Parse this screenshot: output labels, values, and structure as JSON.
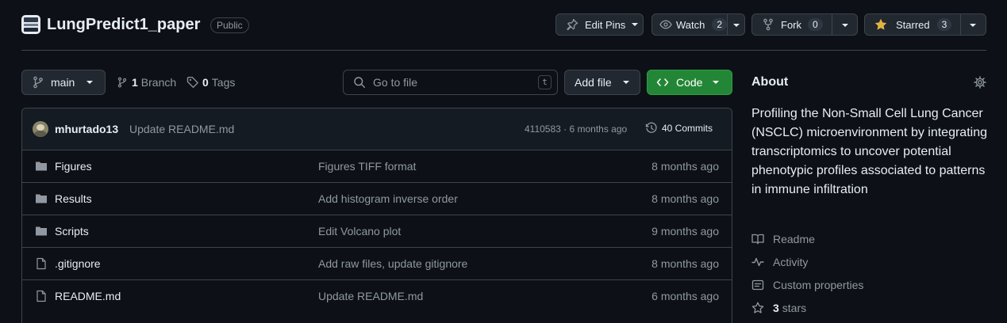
{
  "repo": {
    "name": "LungPredict1_paper",
    "visibility": "Public"
  },
  "header_actions": {
    "edit_pins": "Edit Pins",
    "watch": "Watch",
    "watch_count": "2",
    "fork": "Fork",
    "fork_count": "0",
    "starred": "Starred",
    "star_count": "3"
  },
  "toolbar": {
    "branch": "main",
    "branch_count": "1",
    "branch_label": "Branch",
    "tag_count": "0",
    "tag_label": "Tags",
    "go_to_file_placeholder": "Go to file",
    "go_to_file_key": "t",
    "add_file": "Add file",
    "code": "Code"
  },
  "latest_commit": {
    "author": "mhurtado13",
    "message": "Update README.md",
    "hash_time": "4110583 · 6 months ago",
    "commits_label": "40 Commits"
  },
  "files": [
    {
      "name": "Figures",
      "type": "dir",
      "message": "Figures TIFF format",
      "date": "8 months ago"
    },
    {
      "name": "Results",
      "type": "dir",
      "message": "Add histogram inverse order",
      "date": "8 months ago"
    },
    {
      "name": "Scripts",
      "type": "dir",
      "message": "Edit Volcano plot",
      "date": "9 months ago"
    },
    {
      "name": ".gitignore",
      "type": "file",
      "message": "Add raw files, update gitignore",
      "date": "8 months ago"
    },
    {
      "name": "README.md",
      "type": "file",
      "message": "Update README.md",
      "date": "6 months ago"
    }
  ],
  "about": {
    "heading": "About",
    "description": "Profiling the Non-Small Cell Lung Cancer (NSCLC) microenvironment by integrating transcriptomics to uncover potential phenotypic profiles associated to patterns in immune infiltration",
    "links": {
      "readme": "Readme",
      "activity": "Activity",
      "custom_properties": "Custom properties",
      "stars_count": "3",
      "stars_label": "stars"
    }
  },
  "colors": {
    "background": "#0d1117",
    "border": "#3d444d",
    "muted_text": "#9198a1",
    "code_button": "#238636",
    "star_yellow": "#e3b341"
  }
}
